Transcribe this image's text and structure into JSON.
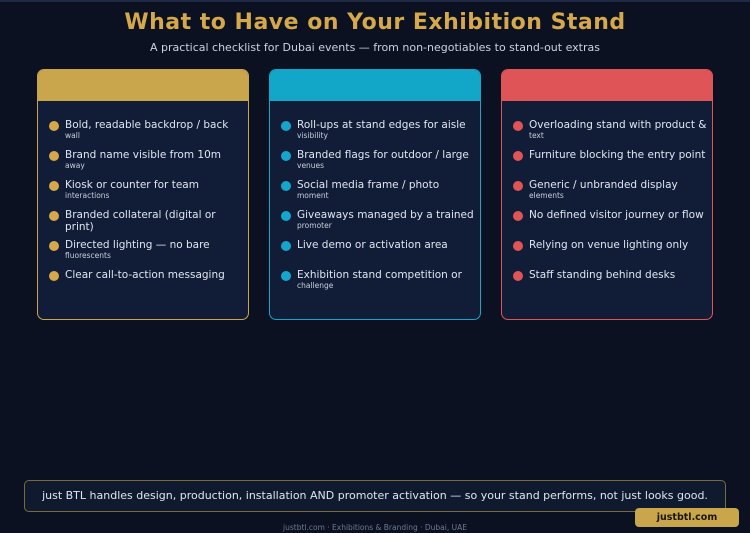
{
  "title": "What to Have on Your Exhibition Stand",
  "subtitle": "A practical checklist for Dubai events — from non-negotiables to stand-out extras",
  "colors": {
    "gold": "#c9a54c",
    "blue": "#12a6c9",
    "red": "#df5557",
    "background": "#0b1120"
  },
  "columns": [
    {
      "items": [
        {
          "text": "Bold, readable backdrop / back",
          "sub": "wall"
        },
        {
          "text": "Brand name visible from 10m",
          "sub": "away"
        },
        {
          "text": "Kiosk or counter for team",
          "sub": "interactions"
        },
        {
          "text": "Branded collateral (digital or print)",
          "sub": ""
        },
        {
          "text": "Directed lighting — no bare",
          "sub": "fluorescents"
        },
        {
          "text": "Clear call-to-action messaging",
          "sub": ""
        }
      ]
    },
    {
      "items": [
        {
          "text": "Roll-ups at stand edges for aisle",
          "sub": "visibility"
        },
        {
          "text": "Branded flags for outdoor / large",
          "sub": "venues"
        },
        {
          "text": "Social media frame / photo",
          "sub": "moment"
        },
        {
          "text": "Giveaways managed by a trained",
          "sub": "promoter"
        },
        {
          "text": "Live demo or activation area",
          "sub": ""
        },
        {
          "text": "Exhibition stand competition or",
          "sub": "challenge"
        }
      ]
    },
    {
      "items": [
        {
          "text": "Overloading stand with product &",
          "sub": "text"
        },
        {
          "text": "Furniture blocking the entry point",
          "sub": ""
        },
        {
          "text": "Generic / unbranded display",
          "sub": "elements"
        },
        {
          "text": "No defined visitor journey or flow",
          "sub": ""
        },
        {
          "text": "Relying on venue lighting only",
          "sub": ""
        },
        {
          "text": "Staff standing behind desks",
          "sub": ""
        }
      ]
    }
  ],
  "banner": "just BTL handles design, production, installation AND promoter activation — so your stand performs, not just looks good.",
  "footer": "justbtl.com  ·  Exhibitions & Branding  ·  Dubai, UAE",
  "badge": "justbtl.com"
}
